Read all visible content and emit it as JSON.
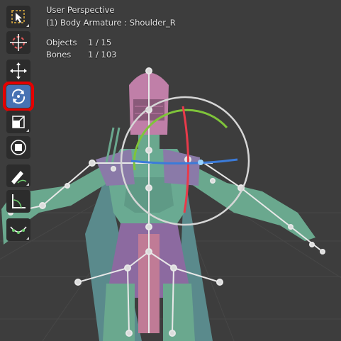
{
  "viewport": {
    "title": "User Perspective",
    "subtitle": "(1) Body Armature : Shoulder_R",
    "stats": {
      "objects_label": "Objects",
      "objects_value": "1 / 15",
      "bones_label": "Bones",
      "bones_value": "1 / 103"
    }
  },
  "toolbar": {
    "tools": [
      {
        "name": "select-box-tool",
        "icon": "select-box-icon",
        "active": false
      },
      {
        "name": "cursor-tool",
        "icon": "cursor-icon",
        "active": false
      },
      {
        "name": "move-tool",
        "icon": "move-icon",
        "active": false
      },
      {
        "name": "rotate-tool",
        "icon": "rotate-icon",
        "active": true
      },
      {
        "name": "scale-tool",
        "icon": "scale-icon",
        "active": false
      },
      {
        "name": "transform-tool",
        "icon": "transform-icon",
        "active": false
      },
      {
        "name": "annotate-tool",
        "icon": "annotate-icon",
        "active": false
      },
      {
        "name": "measure-tool",
        "icon": "measure-icon",
        "active": false
      },
      {
        "name": "relax-pose-tool",
        "icon": "relax-pose-icon",
        "active": false
      }
    ]
  },
  "colors": {
    "viewport_bg": "#3d3d3d",
    "active_tool": "#4772b3",
    "highlight": "#e60000",
    "gizmo_x": "#e83a4a",
    "gizmo_y": "#7fc43a",
    "gizmo_z": "#3b7bd9",
    "gizmo_view": "#d6d6d6"
  }
}
